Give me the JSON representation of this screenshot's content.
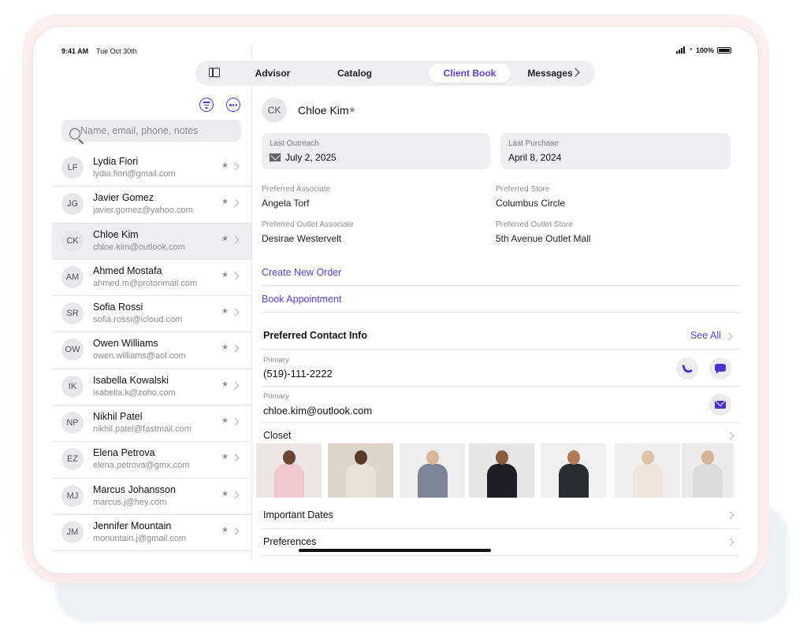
{
  "status": {
    "time": "9:41 AM",
    "date": "Tue Oct 30th",
    "battery": "100%"
  },
  "tabs": [
    {
      "label": "Advisor"
    },
    {
      "label": "Catalog"
    },
    {
      "label": "Client Book",
      "active": true
    },
    {
      "label": "Messages"
    }
  ],
  "search": {
    "placeholder": "Name, email, phone, notes"
  },
  "clients": [
    {
      "initials": "LF",
      "name": "Lydia Fiori",
      "email": "lydia.fiori@gmail.com"
    },
    {
      "initials": "JG",
      "name": "Javier Gomez",
      "email": "javier.gomez@yahoo.com"
    },
    {
      "initials": "CK",
      "name": "Chloe Kim",
      "email": "chloe.kim@outlook.com",
      "selected": true
    },
    {
      "initials": "AM",
      "name": "Ahmed Mostafa",
      "email": "ahmed.m@protonmail.com"
    },
    {
      "initials": "SR",
      "name": "Sofia Rossi",
      "email": "sofia.rossi@icloud.com"
    },
    {
      "initials": "OW",
      "name": "Owen Williams",
      "email": "owen.williams@aol.com"
    },
    {
      "initials": "IK",
      "name": "Isabella Kowalski",
      "email": "isabella.k@zoho.com"
    },
    {
      "initials": "NP",
      "name": "Nikhil Patel",
      "email": "nikhil.patel@fastmail.com"
    },
    {
      "initials": "EZ",
      "name": "Elena Petrova",
      "email": "elena.petrova@gmx.com"
    },
    {
      "initials": "MJ",
      "name": "Marcus Johansson",
      "email": "marcus.j@hey.com"
    },
    {
      "initials": "JM",
      "name": "Jennifer Mountain",
      "email": "monuntain.j@gmail.com"
    }
  ],
  "detail": {
    "initials": "CK",
    "name": "Chloe Kim",
    "last_outreach_label": "Last Outreach",
    "last_outreach": "July 2, 2025",
    "last_purchase_label": "Last Purchase",
    "last_purchase": "April 8, 2024",
    "preferred_associate_label": "Preferred Associate",
    "preferred_associate": "Angela Torf",
    "preferred_store_label": "Preferred Store",
    "preferred_store": "Columbus Circle",
    "preferred_outlet_associate_label": "Preferred Outlet Associate",
    "preferred_outlet_associate": "Desirae Westervelt",
    "preferred_outlet_store_label": "Preferred Outlet Store",
    "preferred_outlet_store": "5th Avenue Outlet Mall",
    "create_order": "Create New Order",
    "book_appointment": "Book Appointment",
    "contact_title": "Preferred Contact Info",
    "see_all": "See All",
    "phone_label": "Primary",
    "phone": "(519)-111-2222",
    "email_label": "Primary",
    "email": "chloe.kim@outlook.com",
    "closet": "Closet",
    "important_dates": "Important Dates",
    "preferences": "Preferences"
  },
  "closet_items": [
    {
      "bg": "#ece6e4",
      "top": "#f0c9cf",
      "skin": "#6b4633"
    },
    {
      "bg": "#ddd6cc",
      "top": "#e9e2d6",
      "skin": "#5a3a2a"
    },
    {
      "bg": "#eeeeee",
      "top": "#7d8494",
      "skin": "#d9b59a"
    },
    {
      "bg": "#e6e6e6",
      "top": "#1e1e24",
      "skin": "#8a5a3c"
    },
    {
      "bg": "#f0f0f0",
      "top": "#2b2b33",
      "skin": "#b07a55"
    },
    {
      "bg": "#efefef",
      "top": "#efe6da",
      "skin": "#e2c2a6"
    },
    {
      "bg": "#ebebeb",
      "top": "#dcdcdc",
      "skin": "#d8b497"
    }
  ]
}
